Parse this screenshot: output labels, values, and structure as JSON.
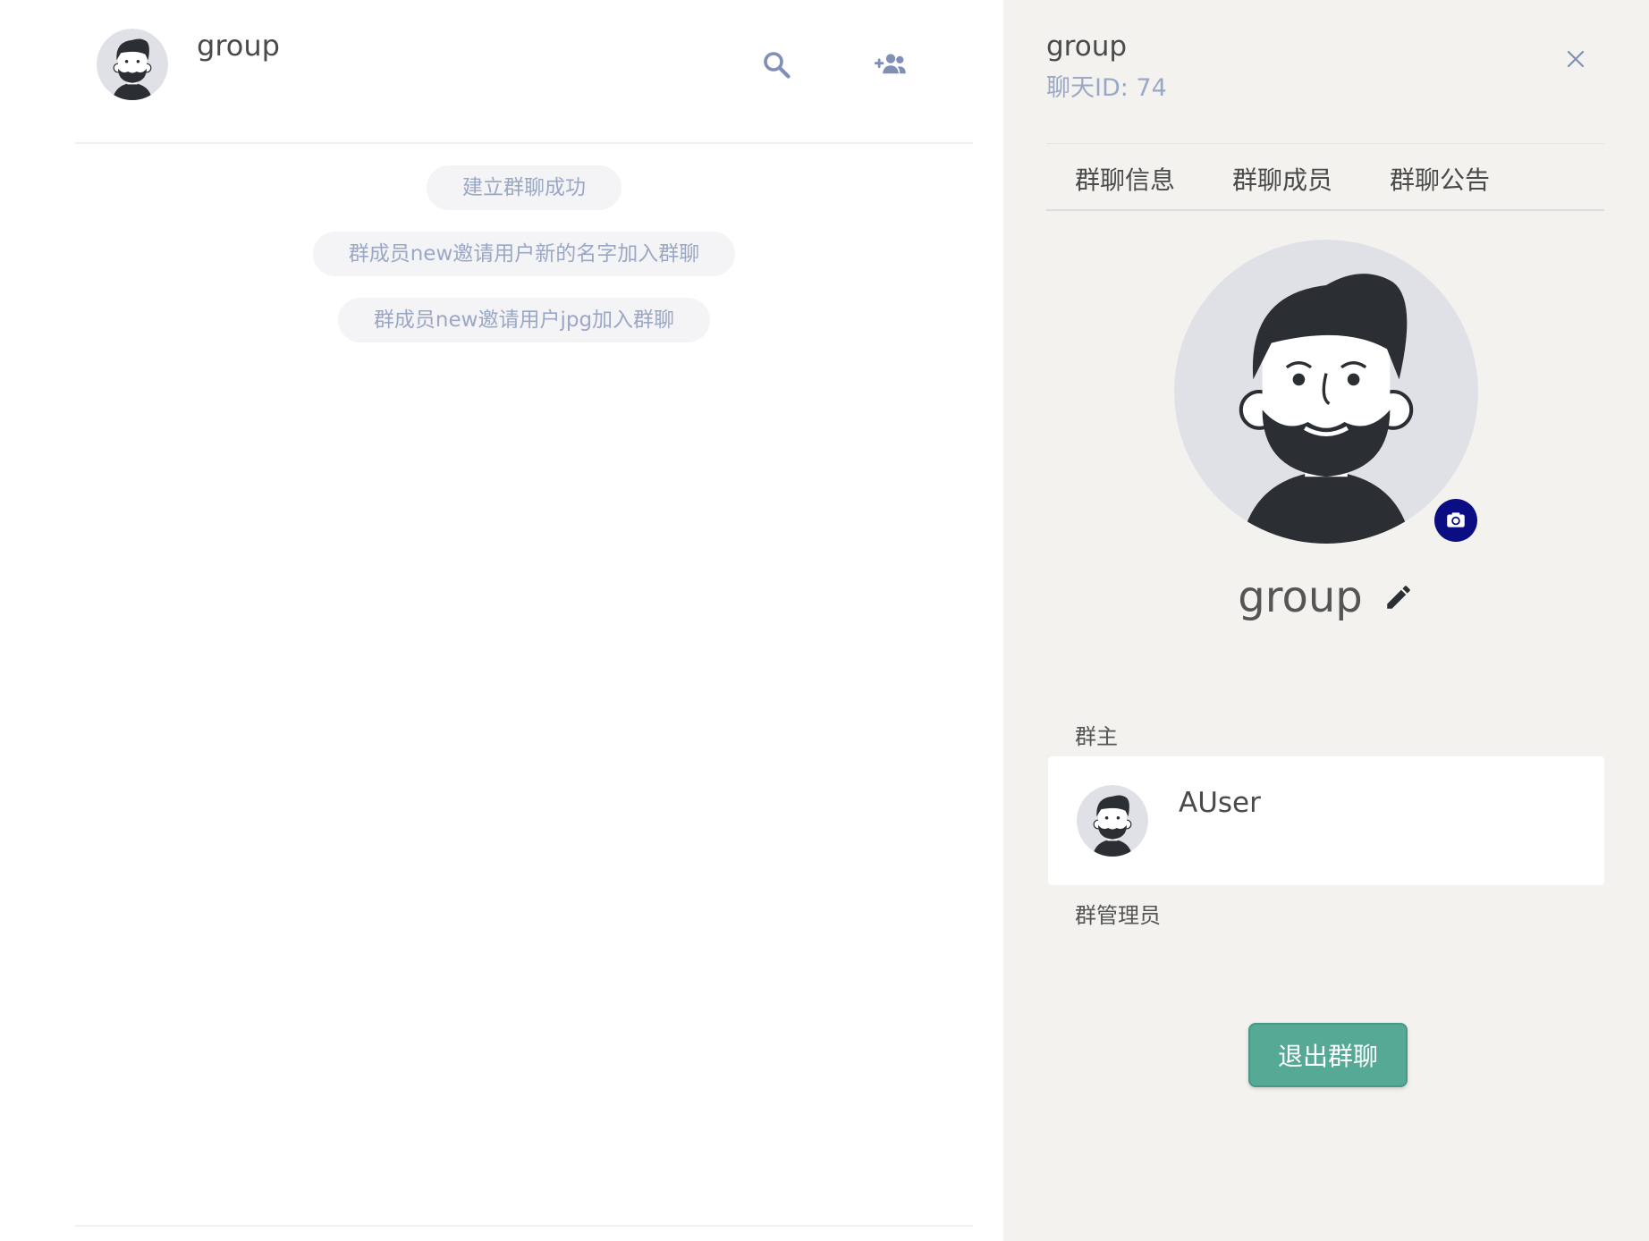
{
  "chat": {
    "title": "group",
    "messages": [
      "建立群聊成功",
      "群成员new邀请用户新的名字加入群聊",
      "群成员new邀请用户jpg加入群聊"
    ]
  },
  "info": {
    "title": "group",
    "chat_id": "聊天ID: 74",
    "tabs": [
      "群聊信息",
      "群聊成员",
      "群聊公告"
    ],
    "group_name": "group",
    "owner_label": "群主",
    "owner_name": "AUser",
    "admin_label": "群管理员",
    "leave_button": "退出群聊"
  },
  "icons": {
    "search": "search-icon",
    "add_member": "group-add-icon",
    "close": "close-icon",
    "camera": "camera-switch-icon",
    "edit": "pencil-icon"
  },
  "colors": {
    "accent_green": "#55a995",
    "camera_blue": "#0b0d82",
    "icon_blue": "#7f8fb5",
    "system_text": "#9aa8c6"
  }
}
